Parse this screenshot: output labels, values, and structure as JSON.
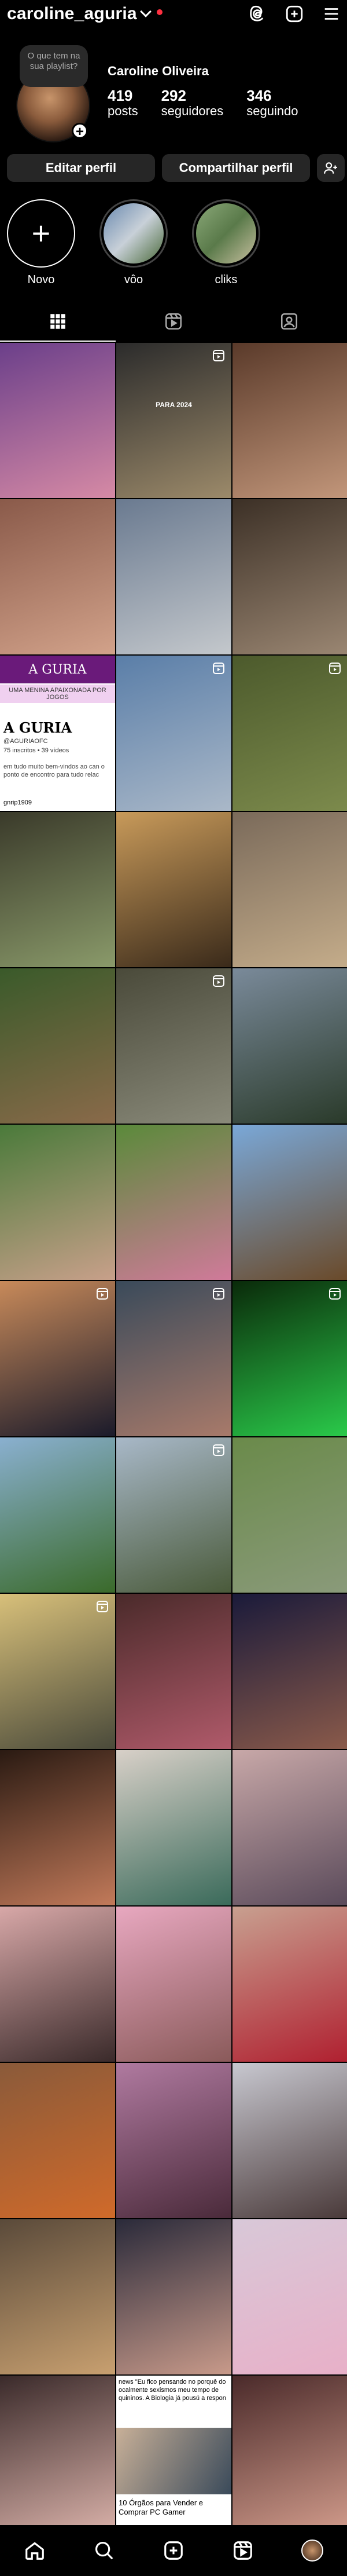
{
  "header": {
    "username": "caroline_aguria",
    "icons": [
      "threads-icon",
      "plus-square-icon",
      "menu-icon"
    ]
  },
  "profile": {
    "note": "O que tem na sua playlist?",
    "display_name": "Caroline Oliveira",
    "stats": [
      {
        "value": "419",
        "label": "posts"
      },
      {
        "value": "292",
        "label": "seguidores"
      },
      {
        "value": "346",
        "label": "seguindo"
      }
    ]
  },
  "actions": {
    "edit_label": "Editar perfil",
    "share_label": "Compartilhar perfil",
    "add_user_icon": "add-user-icon"
  },
  "highlights": [
    {
      "label": "Novo"
    },
    {
      "label": "vôo"
    },
    {
      "label": "cliks"
    }
  ],
  "tabs": [
    "grid-icon",
    "reels-icon",
    "tagged-icon"
  ],
  "posts": [
    {
      "caption": "",
      "colors": [
        "#6b3f8a",
        "#d68aa5"
      ],
      "badge": ""
    },
    {
      "caption": "PARA 2024",
      "colors": [
        "#2b2b2b",
        "#9c8a6a"
      ],
      "badge": "reel"
    },
    {
      "caption": "",
      "colors": [
        "#5a3a2a",
        "#c2967a"
      ],
      "badge": ""
    },
    {
      "caption": "",
      "colors": [
        "#8a5a4a",
        "#d2a28a"
      ],
      "badge": ""
    },
    {
      "caption": "",
      "colors": [
        "#6a7a90",
        "#c4c8cc"
      ],
      "badge": ""
    },
    {
      "caption": "",
      "colors": [
        "#3c3026",
        "#9a8672"
      ],
      "badge": ""
    },
    {
      "caption": "",
      "colors": [
        "#ffffff",
        "#ffffff"
      ],
      "badge": "",
      "guria": true,
      "guria_band": "A GURIA",
      "guria_sub": "UMA MENINA APAIXONADA POR JOGOS",
      "guria_big": "A GURIA",
      "guria_handle": "@AGURIAOFC",
      "guria_counts": "75 inscritos • 39 vídeos",
      "guria_desc": "em tudo muito bem-vindos ao can o ponto de encontro para tudo relac",
      "guria_link": "gnrip1909"
    },
    {
      "caption": "",
      "colors": [
        "#5a7ea8",
        "#aab8c8"
      ],
      "badge": "reel"
    },
    {
      "caption": "",
      "colors": [
        "#4c5a2c",
        "#7c8a4c"
      ],
      "badge": "reel"
    },
    {
      "caption": "",
      "colors": [
        "#3a3a2a",
        "#8a9a6a"
      ],
      "badge": ""
    },
    {
      "caption": "",
      "colors": [
        "#c89a5a",
        "#3a2a1a"
      ],
      "badge": ""
    },
    {
      "caption": "",
      "colors": [
        "#7a6a5a",
        "#c4ac8a"
      ],
      "badge": ""
    },
    {
      "caption": "",
      "colors": [
        "#3a5a2a",
        "#8a6a4a"
      ],
      "badge": ""
    },
    {
      "caption": "",
      "colors": [
        "#4a4a3a",
        "#8a8a7a"
      ],
      "badge": "reel"
    },
    {
      "caption": "",
      "colors": [
        "#7a8a9a",
        "#2a3a2a"
      ],
      "badge": ""
    },
    {
      "caption": "",
      "colors": [
        "#4a7a3a",
        "#c8a08a"
      ],
      "badge": ""
    },
    {
      "caption": "",
      "colors": [
        "#5a8a3a",
        "#d07a9a"
      ],
      "badge": ""
    },
    {
      "caption": "",
      "colors": [
        "#7aa8d8",
        "#6a4a2a"
      ],
      "badge": ""
    },
    {
      "caption": "",
      "colors": [
        "#c88a5a",
        "#1a1a2a"
      ],
      "badge": "reel"
    },
    {
      "caption": "",
      "colors": [
        "#3a4a5a",
        "#a87a6a"
      ],
      "badge": "reel"
    },
    {
      "caption": "",
      "colors": [
        "#0a2a0a",
        "#2aca4a"
      ],
      "badge": "reel"
    },
    {
      "caption": "",
      "colors": [
        "#8ab0d0",
        "#3a6a2a"
      ],
      "badge": ""
    },
    {
      "caption": "",
      "colors": [
        "#a8b8c8",
        "#4a5a3a"
      ],
      "badge": "reel"
    },
    {
      "caption": "",
      "colors": [
        "#6a8a4a",
        "#8a9a7a"
      ],
      "badge": ""
    },
    {
      "caption": "",
      "colors": [
        "#d8c07a",
        "#4a4a3a"
      ],
      "badge": "reel"
    },
    {
      "caption": "",
      "colors": [
        "#4a2a2a",
        "#b05a6a"
      ],
      "badge": ""
    },
    {
      "caption": "",
      "colors": [
        "#1a1a3a",
        "#8a5a4a"
      ],
      "badge": ""
    },
    {
      "caption": "",
      "colors": [
        "#2a1a12",
        "#c27a5a"
      ],
      "badge": ""
    },
    {
      "caption": "",
      "colors": [
        "#d8d0c8",
        "#3a6a5a"
      ],
      "badge": ""
    },
    {
      "caption": "",
      "colors": [
        "#c8a8a8",
        "#5a4a5a"
      ],
      "badge": ""
    },
    {
      "caption": "",
      "colors": [
        "#d8a8a8",
        "#3a2a2a"
      ],
      "badge": ""
    },
    {
      "caption": "",
      "colors": [
        "#e8a8c0",
        "#8a5a5a"
      ],
      "badge": ""
    },
    {
      "caption": "",
      "colors": [
        "#c8a090",
        "#b02030"
      ],
      "badge": ""
    },
    {
      "caption": "",
      "colors": [
        "#8a5a3a",
        "#d06a2a"
      ],
      "badge": ""
    },
    {
      "caption": "",
      "colors": [
        "#b07aa0",
        "#4a2a3a"
      ],
      "badge": ""
    },
    {
      "caption": "",
      "colors": [
        "#c8c8d0",
        "#4a3a3a"
      ],
      "badge": ""
    },
    {
      "caption": "",
      "colors": [
        "#5a4a3a",
        "#c8a070"
      ],
      "badge": ""
    },
    {
      "caption": "",
      "colors": [
        "#2a2a3a",
        "#c89a8a"
      ],
      "badge": ""
    },
    {
      "caption": "",
      "colors": [
        "#d8c8d8",
        "#e8b0c8"
      ],
      "badge": ""
    },
    {
      "caption": "",
      "colors": [
        "#3a2a2a",
        "#d8b0a8"
      ],
      "badge": ""
    },
    {
      "caption": "",
      "colors": [
        "#ffffff",
        "#ffffff"
      ],
      "badge": "",
      "news": true,
      "news_top": "news \"Eu fico pensando no porquê do ocalmente sexismos meu tempo de quininos. A Biologia já pousú a respon",
      "news_bottom": "10 Órgãos para Vender e Comprar PC Gamer"
    },
    {
      "caption": "",
      "colors": [
        "#4a2a2a",
        "#d09a8a"
      ],
      "badge": ""
    },
    {
      "caption": "",
      "colors": [
        "#6a6a7a",
        "#2a2a3a"
      ],
      "badge": ""
    },
    {
      "caption": "",
      "colors": [
        "#3a4a4a",
        "#1a2a2a"
      ],
      "badge": ""
    },
    {
      "caption": "",
      "colors": [
        "#5a3a3a",
        "#2a1a1a"
      ],
      "badge": ""
    }
  ],
  "bottom_nav": [
    "home-icon",
    "search-icon",
    "create-icon",
    "reels-icon",
    "profile-avatar"
  ]
}
